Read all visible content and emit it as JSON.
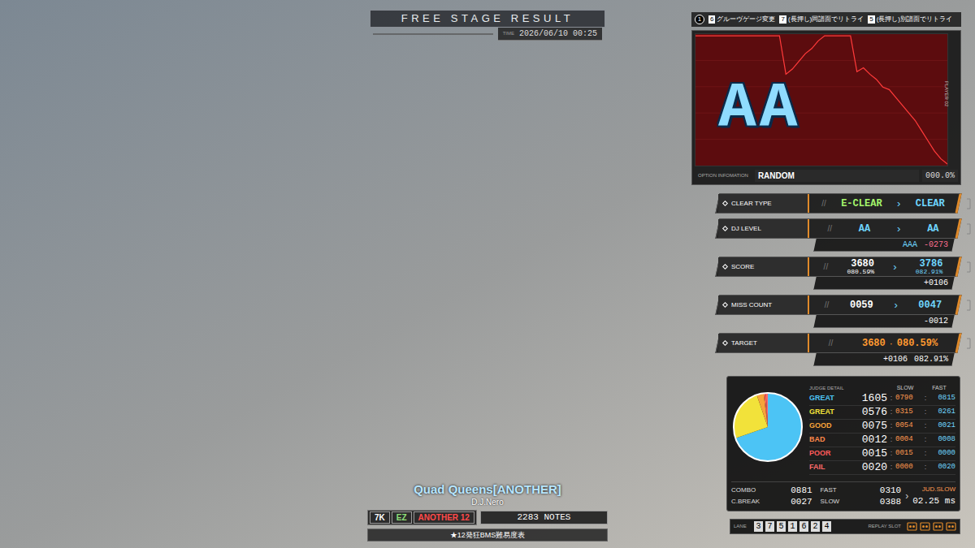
{
  "header": {
    "title": "FREE STAGE RESULT",
    "time_label": "TIME",
    "time": "2026/06/10 00:25"
  },
  "key_hints": {
    "player": "1",
    "items": [
      {
        "key": "6",
        "label": "グルーヴゲージ変更"
      },
      {
        "key": "7",
        "label": "(長押し)同譜面でリトライ"
      },
      {
        "key": "5",
        "label": "(長押し)別譜面でリトライ"
      }
    ]
  },
  "graph": {
    "rank": "AA",
    "side_label": "PLAYER 02",
    "gauge": [
      100,
      100,
      100,
      100,
      100,
      100,
      100,
      100,
      100,
      100,
      100,
      100,
      100,
      100,
      70,
      74,
      80,
      86,
      90,
      96,
      100,
      100,
      100,
      100,
      100,
      72,
      75,
      70,
      66,
      60,
      58,
      52,
      46,
      40,
      34,
      26,
      18,
      10,
      4,
      0
    ],
    "option_label": "OPTION INFOMATION",
    "option": "RANDOM",
    "rate": "000.0%"
  },
  "rows": [
    {
      "kind": "compare",
      "label": "CLEAR TYPE",
      "arrow": "›",
      "before": {
        "main": "E-CLEAR",
        "extra": "",
        "color": "#a4f56c"
      },
      "after": {
        "main": "CLEAR",
        "extra": "",
        "color": "#6fd6ff"
      },
      "sub": []
    },
    {
      "kind": "compare",
      "label": "DJ LEVEL",
      "arrow": "›",
      "before": {
        "main": "AA",
        "extra": "",
        "color": "#6fd6ff"
      },
      "after": {
        "main": "AA",
        "extra": "",
        "color": "#6fd6ff"
      },
      "sub": [
        {
          "text": "AAA",
          "color": "#6fd6ff"
        },
        {
          "text": "-0273",
          "color": "#ff6f8f"
        }
      ]
    },
    {
      "kind": "compare",
      "label": "SCORE",
      "arrow": "›",
      "before": {
        "main": "3680",
        "extra": "080.59%",
        "color": "#ffffff"
      },
      "after": {
        "main": "3786",
        "extra": "082.91%",
        "color": "#6fd6ff"
      },
      "sub": [
        {
          "text": "+0106",
          "color": "#ffffff"
        }
      ]
    },
    {
      "kind": "compare",
      "label": "MISS COUNT",
      "arrow": "›",
      "before": {
        "main": "0059",
        "extra": "",
        "color": "#ffffff"
      },
      "after": {
        "main": "0047",
        "extra": "",
        "color": "#6fd6ff"
      },
      "sub": [
        {
          "text": "-0012",
          "color": "#ffffff"
        }
      ]
    },
    {
      "kind": "target",
      "label": "TARGET",
      "arrow": "·",
      "before": {
        "main": "3680",
        "extra": "080.59%",
        "color": "#ff9a30"
      },
      "after": {
        "main": "",
        "extra": "",
        "color": "#ff9a30"
      },
      "sub": [
        {
          "text": "+0106",
          "color": "#ffffff"
        },
        {
          "text": "082.91%",
          "color": "#ffffff"
        }
      ]
    }
  ],
  "judge": {
    "title": "JUDGE DETAIL",
    "columns": [
      "SLOW",
      "FAST"
    ],
    "separator": ":",
    "rows": [
      {
        "label": "GREAT",
        "total": "1605",
        "slow": "0790",
        "fast": "0815",
        "count": 1605,
        "color": "#4cc4f5"
      },
      {
        "label": "GREAT",
        "total": "0576",
        "slow": "0315",
        "fast": "0261",
        "count": 576,
        "color": "#f2e23a"
      },
      {
        "label": "GOOD",
        "total": "0075",
        "slow": "0054",
        "fast": "0021",
        "count": 75,
        "color": "#f7a43a"
      },
      {
        "label": "BAD",
        "total": "0012",
        "slow": "0004",
        "fast": "0008",
        "count": 12,
        "color": "#ff8a4a"
      },
      {
        "label": "POOR",
        "total": "0015",
        "slow": "0015",
        "fast": "0000",
        "count": 15,
        "color": "#ff5a5a"
      },
      {
        "label": "FAIL",
        "total": "0020",
        "slow": "0000",
        "fast": "0020",
        "count": 20,
        "color": "#ff6a6a"
      }
    ],
    "stats": [
      {
        "label": "COMBO",
        "value": "0881"
      },
      {
        "label": "FAST",
        "value": "0310"
      },
      {
        "label": "C.BREAK",
        "value": "0027"
      },
      {
        "label": "SLOW",
        "value": "0388"
      }
    ],
    "timing": {
      "arrow": "›",
      "label": "JUD.SLOW",
      "value": "02.25 ms"
    }
  },
  "lane": {
    "label": "LANE",
    "order": [
      "3",
      "7",
      "5",
      "1",
      "6",
      "2",
      "4"
    ],
    "slot_label": "REPLAY SLOT",
    "slots": [
      {
        "saved": true
      },
      {
        "saved": true
      },
      {
        "saved": true
      },
      {
        "saved": true
      }
    ]
  },
  "song": {
    "title": "Quad Queens[ANOTHER]",
    "artist": "D.J.Nero",
    "tags": [
      {
        "label": "7K",
        "color": "#ffffff"
      },
      {
        "label": "EZ",
        "color": "#8fe07a"
      },
      {
        "label": "ANOTHER 12",
        "color": "#ff4a4a"
      }
    ],
    "notes": "2283 NOTES",
    "table": "★12発狂BMS難易度表"
  }
}
